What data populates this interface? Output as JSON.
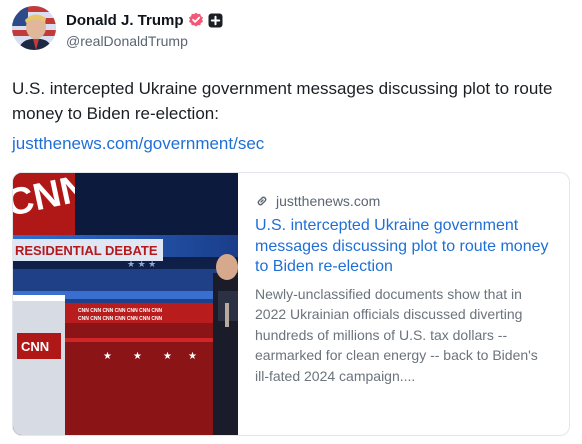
{
  "author": {
    "display_name": "Donald J. Trump",
    "handle": "@realDonaldTrump",
    "avatar_icon": "profile-photo",
    "verified_icon": "verified-badge-icon",
    "verified_color": "#f05a78",
    "plus_icon": "plus-badge-icon"
  },
  "post": {
    "text": "U.S. intercepted Ukraine government messages discussing plot to route money to Biden re-election:",
    "link_text": "justthenews.com/government/sec",
    "link_color": "#1f6fd6"
  },
  "card": {
    "domain": "justthenews.com",
    "domain_icon": "link-icon",
    "title": "U.S. intercepted Ukraine government messages discussing plot to route money to Biden re-election",
    "description": "Newly-unclassified documents show that in 2022 Ukrainian officials discussed diverting hundreds of millions of U.S. tax dollars -- earmarked for clean energy -- back to Biden's ill-fated 2024 campaign....",
    "image": {
      "description_icon": "debate-stage-photo",
      "banner_text": "RESIDENTIAL DEBATE",
      "logo_text": "CNN"
    }
  }
}
